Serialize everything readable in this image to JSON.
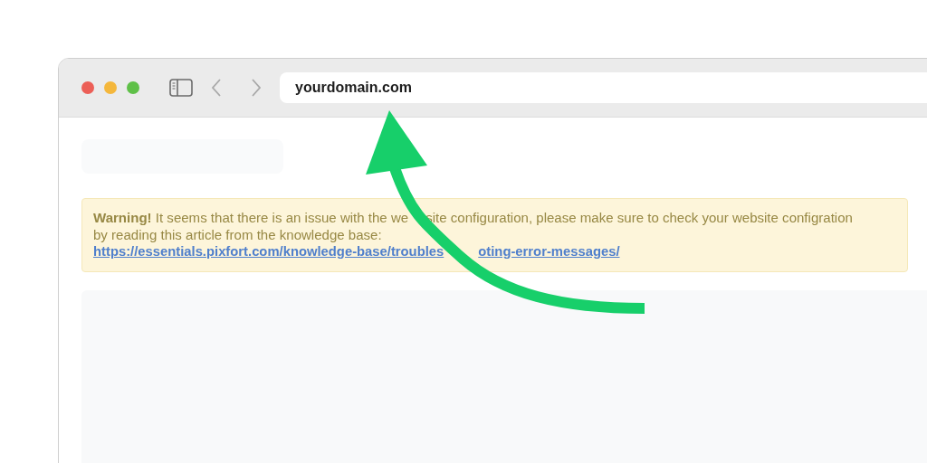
{
  "window": {
    "traffic_lights": [
      {
        "color": "#ec5f57"
      },
      {
        "color": "#f4b73c"
      },
      {
        "color": "#5fc048"
      }
    ]
  },
  "address_bar": {
    "value": "yourdomain.com"
  },
  "warning": {
    "lines": [
      [
        "**Warning!** It seems that there is an issue with the we",
        "site configuration, please make sure to check your website configration"
      ],
      [
        "by reading this article from the knowledge base:"
      ]
    ],
    "link": [
      "https://essentials.pixfort.com/knowledge-base/troubles",
      "oting-error-messages/"
    ]
  }
}
